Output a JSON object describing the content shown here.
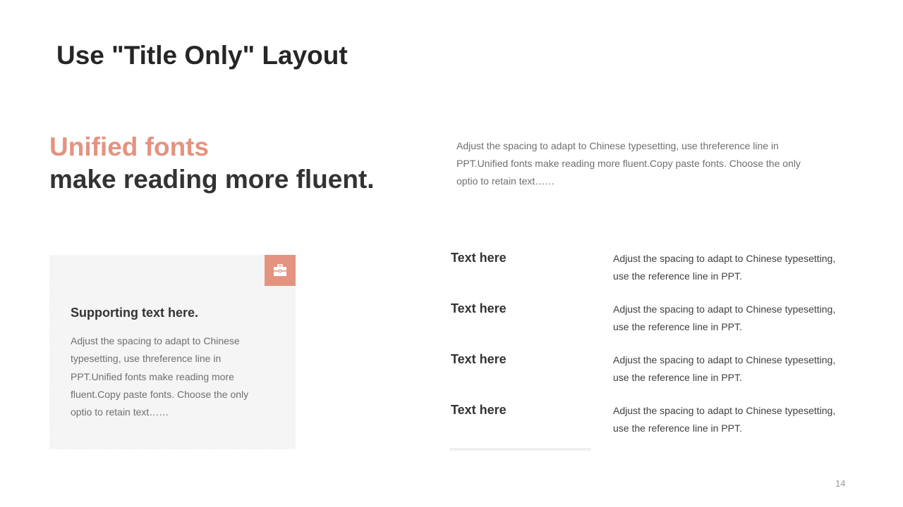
{
  "slide": {
    "title": "Use \"Title Only\" Layout",
    "headline_accent": "Unified fonts",
    "headline_main": "make reading more fluent.",
    "intro_text": "Adjust the spacing to adapt to Chinese typesetting, use threference line in PPT.Unified fonts make reading more fluent.Copy paste fonts. Choose the only optio to retain text……",
    "accent_color": "#e39380",
    "page_number": "14"
  },
  "card": {
    "icon": "briefcase-icon",
    "title": "Supporting text here.",
    "body": "Adjust the spacing to adapt to Chinese typesetting, use threference line in PPT.Unified fonts make reading more fluent.Copy paste fonts. Choose the only optio to retain text……"
  },
  "list": {
    "items": [
      {
        "label": "Text here",
        "desc": "Adjust the spacing to adapt to Chinese typesetting, use the reference line in PPT."
      },
      {
        "label": "Text here",
        "desc": "Adjust the spacing to adapt to Chinese typesetting, use the reference line in PPT."
      },
      {
        "label": "Text here",
        "desc": "Adjust the spacing to adapt to Chinese typesetting, use the reference line in PPT."
      },
      {
        "label": "Text here",
        "desc": "Adjust the spacing to adapt to Chinese typesetting, use the reference line in PPT."
      }
    ]
  }
}
